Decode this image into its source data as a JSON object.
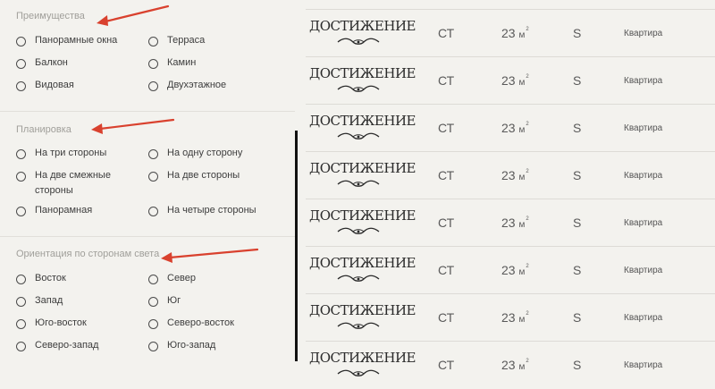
{
  "filters": {
    "groups": [
      {
        "title": "Преимущества",
        "options": [
          "Панорамные окна",
          "Терраса",
          "Балкон",
          "Камин",
          "Видовая",
          "Двухэтажное"
        ]
      },
      {
        "title": "Планировка",
        "options": [
          "На три стороны",
          "На одну сторону",
          "На две смежные стороны",
          "На две стороны",
          "Панорамная",
          "На четыре стороны"
        ]
      },
      {
        "title": "Ориентация по сторонам света",
        "options": [
          "Восток",
          "Север",
          "Запад",
          "Юг",
          "Юго-восток",
          "Северо-восток",
          "Северо-запад",
          "Юго-запад"
        ]
      }
    ]
  },
  "annotations": {
    "arrow_color": "#d9412e"
  },
  "listings": {
    "rows": [
      {
        "logo": "ДОСТИЖЕНИЕ",
        "code": "СТ",
        "area": "23",
        "area_unit": "м",
        "size": "S",
        "type": "Квартира"
      },
      {
        "logo": "ДОСТИЖЕНИЕ",
        "code": "СТ",
        "area": "23",
        "area_unit": "м",
        "size": "S",
        "type": "Квартира"
      },
      {
        "logo": "ДОСТИЖЕНИЕ",
        "code": "СТ",
        "area": "23",
        "area_unit": "м",
        "size": "S",
        "type": "Квартира"
      },
      {
        "logo": "ДОСТИЖЕНИЕ",
        "code": "СТ",
        "area": "23",
        "area_unit": "м",
        "size": "S",
        "type": "Квартира"
      },
      {
        "logo": "ДОСТИЖЕНИЕ",
        "code": "СТ",
        "area": "23",
        "area_unit": "м",
        "size": "S",
        "type": "Квартира"
      },
      {
        "logo": "ДОСТИЖЕНИЕ",
        "code": "СТ",
        "area": "23",
        "area_unit": "м",
        "size": "S",
        "type": "Квартира"
      },
      {
        "logo": "ДОСТИЖЕНИЕ",
        "code": "СТ",
        "area": "23",
        "area_unit": "м",
        "size": "S",
        "type": "Квартира"
      },
      {
        "logo": "ДОСТИЖЕНИЕ",
        "code": "СТ",
        "area": "23",
        "area_unit": "м",
        "size": "S",
        "type": "Квартира"
      }
    ]
  }
}
